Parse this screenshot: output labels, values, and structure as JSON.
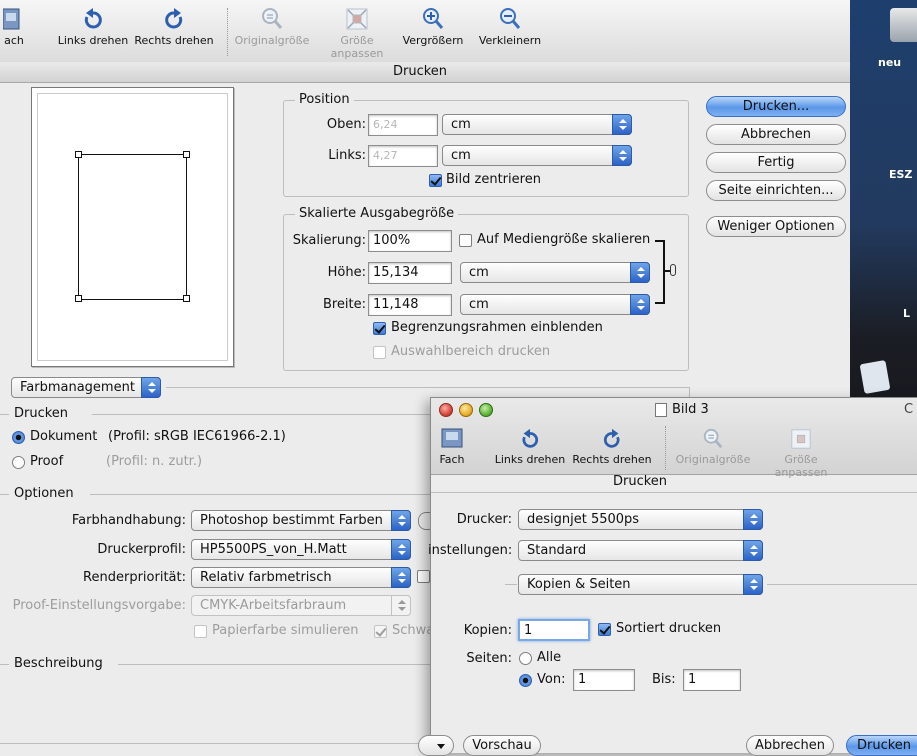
{
  "window_title": "Bild 3",
  "dialog_title": "Drucken",
  "toolbar": {
    "fach": "ach",
    "links_drehen": "Links drehen",
    "rechts_drehen": "Rechts drehen",
    "originalgroesse": "Originalgröße",
    "groesse_anpassen": "Größe anpassen",
    "vergroessern": "Vergrößern",
    "verkleinern": "Verkleinern"
  },
  "desktop": {
    "label_1": "neu",
    "label_2": "ESZ",
    "label_3": "L"
  },
  "position": {
    "legend": "Position",
    "oben_label": "Oben:",
    "oben_value": "6,24",
    "oben_unit": "cm",
    "links_label": "Links:",
    "links_value": "4,27",
    "links_unit": "cm",
    "center_label": "Bild zentrieren"
  },
  "scale": {
    "legend": "Skalierte Ausgabegröße",
    "skalierung_label": "Skalierung:",
    "skalierung_value": "100%",
    "fit_label": "Auf Mediengröße skalieren",
    "hoehe_label": "Höhe:",
    "hoehe_value": "15,134",
    "hoehe_unit": "cm",
    "breite_label": "Breite:",
    "breite_value": "11,148",
    "breite_unit": "cm",
    "bounding_label": "Begrenzungsrahmen einblenden",
    "selection_label": "Auswahlbereich drucken"
  },
  "buttons": {
    "drucken": "Drucken...",
    "abbrechen": "Abbrechen",
    "fertig": "Fertig",
    "seite": "Seite einrichten...",
    "weniger": "Weniger Optionen"
  },
  "color_mgmt": {
    "popup": "Farbmanagement",
    "drucken_legend": "Drucken",
    "dokument_label": "Dokument",
    "dokument_profile": "(Profil: sRGB IEC61966-2.1)",
    "proof_label": "Proof",
    "proof_profile": "(Profil: n. zutr.)",
    "optionen_legend": "Optionen",
    "farbhandhabung_label": "Farbhandhabung:",
    "farbhandhabung_value": "Photoshop bestimmt Farben",
    "druckerprofil_label": "Druckerprofil:",
    "druckerprofil_value": "HP5500PS_von_H.Matt",
    "renderprioritaet_label": "Renderpriorität:",
    "renderprioritaet_value": "Relativ farbmetrisch",
    "proof_setting_label": "Proof-Einstellungsvorgabe:",
    "proof_setting_value": "CMYK-Arbeitsfarbraum",
    "papier_label": "Papierfarbe simulieren",
    "schwarz_label": "Schwa",
    "beschreibung_legend": "Beschreibung"
  },
  "preview_window": {
    "title": "Bild 3",
    "title_right": "C",
    "fach": "Fach",
    "links_drehen": "Links drehen",
    "rechts_drehen": "Rechts drehen",
    "originalgroesse": "Originalgröße",
    "groesse_anpassen": "Größe anpassen",
    "dialog_title": "Drucken"
  },
  "print_dialog": {
    "drucker_label": "Drucker:",
    "drucker_value": "designjet 5500ps",
    "einstellungen_label": "instellungen:",
    "einstellungen_value": "Standard",
    "pane_value": "Kopien & Seiten",
    "kopien_label": "Kopien:",
    "kopien_value": "1",
    "sortiert_label": "Sortiert drucken",
    "seiten_label": "Seiten:",
    "alle_label": "Alle",
    "von_label": "Von:",
    "von_value": "1",
    "bis_label": "Bis:",
    "bis_value": "1",
    "vorschau": "Vorschau",
    "abbrechen": "Abbrechen",
    "drucken": "Drucken"
  }
}
